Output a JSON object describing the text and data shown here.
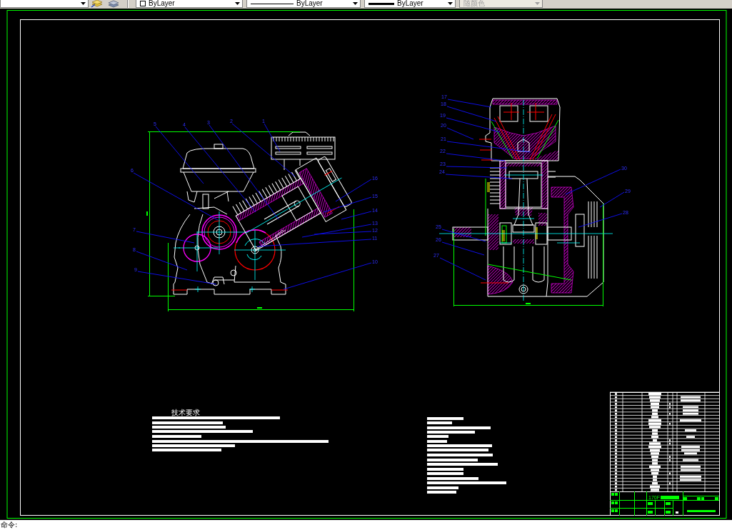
{
  "toolbar": {
    "dropdowns": [
      {
        "kind": "color",
        "value": "ByLayer",
        "disabled": false
      },
      {
        "kind": "linetype",
        "value": "ByLayer",
        "disabled": false
      },
      {
        "kind": "lineweight",
        "value": "ByLayer",
        "disabled": false
      },
      {
        "kind": "plotstyle",
        "value": "随颜色",
        "disabled": true
      }
    ]
  },
  "drawing": {
    "side_view": {
      "callouts": [
        "5",
        "4",
        "3",
        "2",
        "1",
        "6",
        "7",
        "8",
        "9",
        "16",
        "15",
        "14",
        "13",
        "12",
        "11",
        "10"
      ]
    },
    "front_view": {
      "callouts": [
        "17",
        "18",
        "19",
        "20",
        "21",
        "22",
        "23",
        "24",
        "25",
        "26",
        "27",
        "30",
        "29",
        "28"
      ]
    },
    "technical_requirements": {
      "title": "技术要求"
    },
    "title_block": {
      "product_name": "170F"
    }
  },
  "command_line": {
    "prompt": "命令:"
  }
}
